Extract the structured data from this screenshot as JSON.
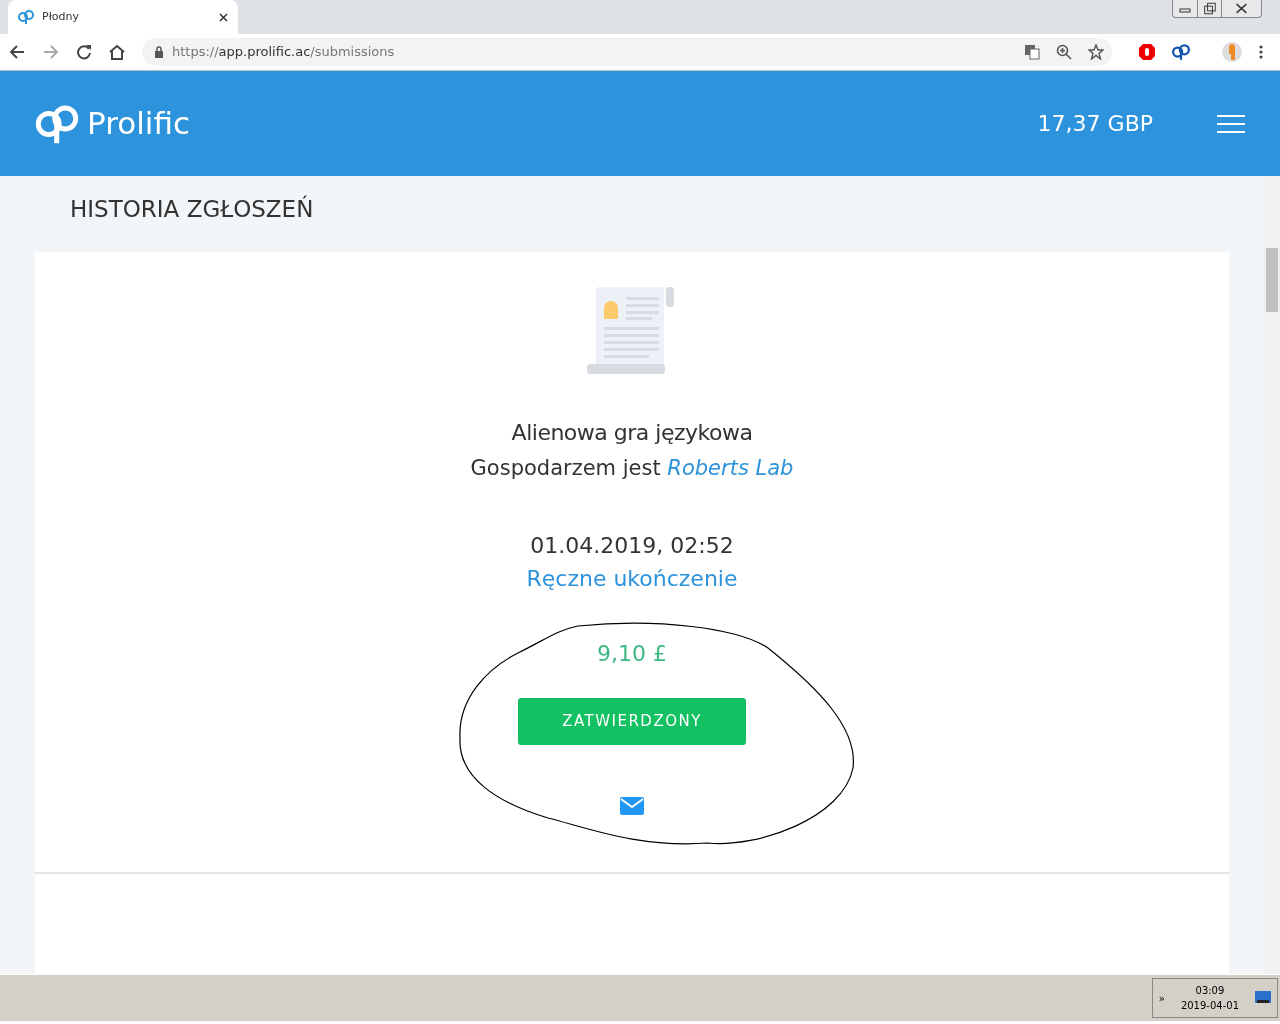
{
  "browser": {
    "tab_title": "Płodny",
    "url": {
      "scheme": "https://",
      "host": "app.prolific.ac",
      "path": "/submissions"
    }
  },
  "header": {
    "logo_text": "Prolific",
    "balance": "17,37 GBP"
  },
  "page_title": "HISTORIA ZGŁOSZEŃ",
  "submission": {
    "study_title": "Alienowa gra językowa",
    "host_prefix": "Gospodarzem jest",
    "host_link": "Roberts Lab",
    "date": "01.04.2019, 02:52",
    "completion": "Ręczne ukończenie",
    "reward": "9,10 £",
    "status": "ZATWIERDZONY",
    "approved": true
  },
  "taskbar": {
    "time": "03:09",
    "date": "2019-04-01",
    "tray_arrow": "»"
  }
}
